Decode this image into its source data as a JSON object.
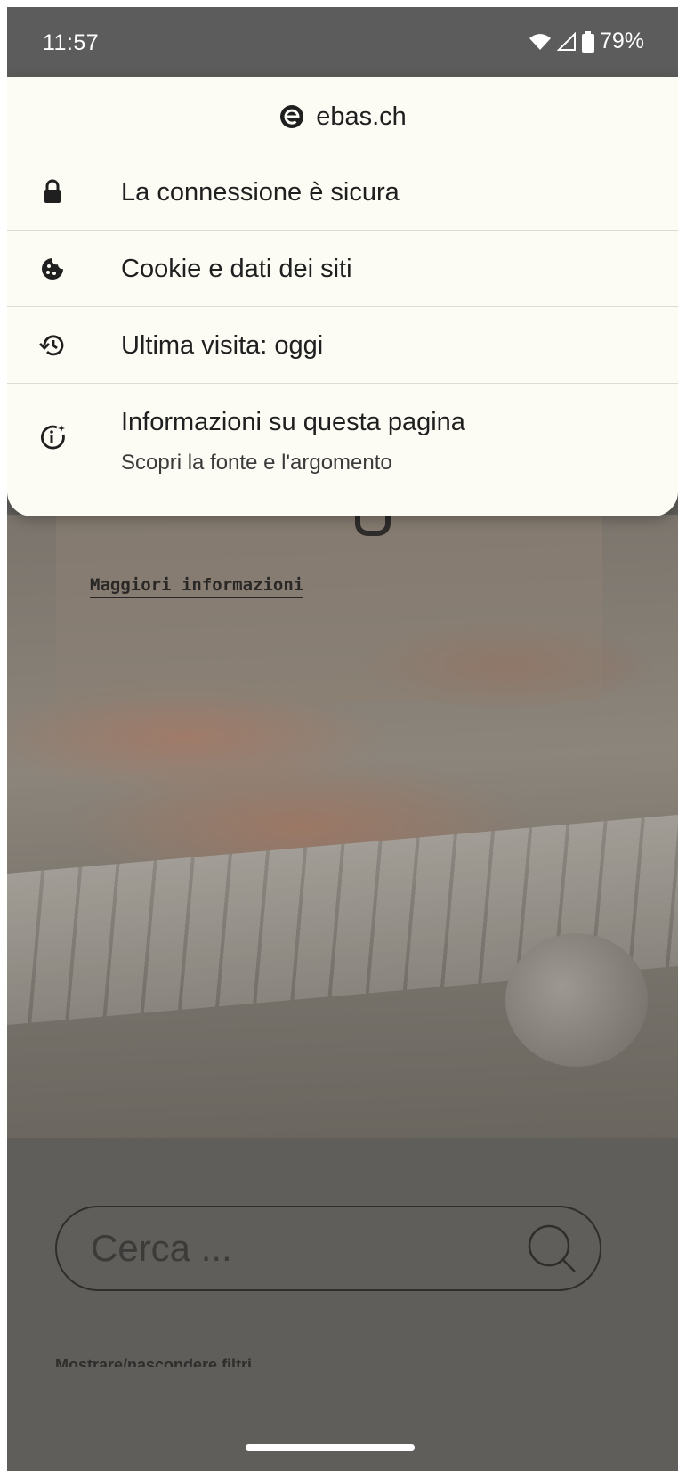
{
  "status_bar": {
    "time": "11:57",
    "battery_percent": "79%",
    "icons": [
      "wifi-icon",
      "signal-icon",
      "battery-icon"
    ]
  },
  "page_info": {
    "site": "ebas.ch",
    "items": [
      {
        "icon": "lock-icon",
        "label": "La connessione è sicura"
      },
      {
        "icon": "cookie-icon",
        "label": "Cookie e dati dei siti"
      },
      {
        "icon": "history-icon",
        "label": "Ultima visita: oggi"
      },
      {
        "icon": "info-sparkle-icon",
        "label": "Informazioni su questa pagina",
        "sublabel": "Scopri la fonte e l'argomento"
      }
    ]
  },
  "page": {
    "more_info_link": "Maggiori informazioni",
    "search": {
      "placeholder": "Cerca ..."
    },
    "filters_toggle": "Mostrare/nascondere filtri"
  },
  "colors": {
    "popup_background": "#fcfcf5",
    "status_bar": "#5c5c5c",
    "scrim": "#5f5e5b"
  }
}
